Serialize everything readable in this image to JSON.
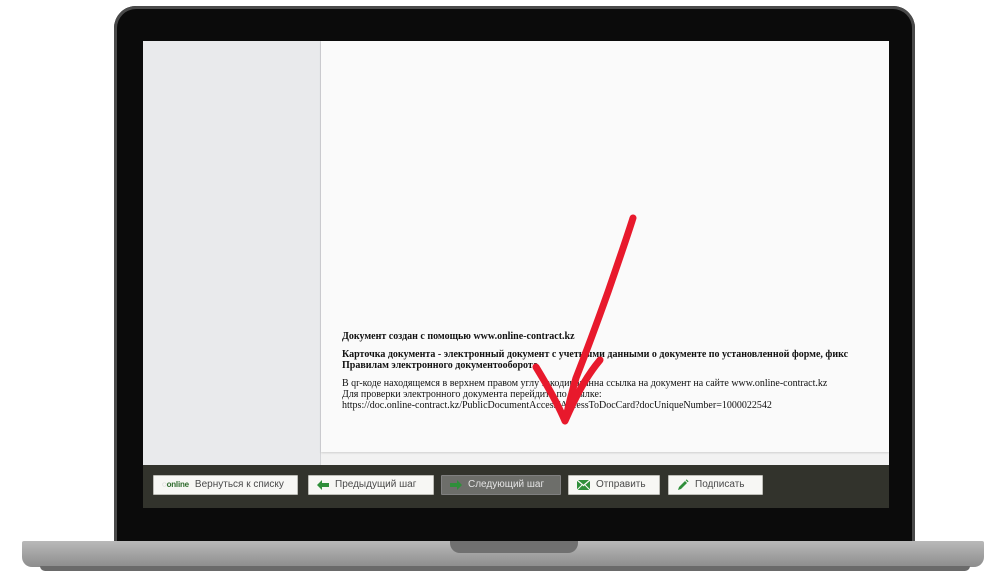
{
  "document": {
    "line1": "Документ создан с помощью www.online-contract.kz",
    "line2": "Карточка документа - электронный документ с учетными данными о документе по установленной форме, фикс",
    "line3": "Правилам электронного документооборота",
    "line4": "В qr-коде находящемся в верхнем правом углу закодированна ссылка на документ на сайте www.online-contract.kz",
    "line5": "Для проверки электронного документа перейдите по ссылке:",
    "line6": "https://doc.online-contract.kz/PublicDocumentAccess/AccessToDocCard?docUniqueNumber=1000022542"
  },
  "toolbar": {
    "logo_text": "online",
    "back_label": "Вернуться к списку",
    "prev_label": "Предыдущий шаг",
    "next_label": "Следующий шаг",
    "send_label": "Отправить",
    "sign_label": "Подписать"
  },
  "colors": {
    "toolbar_bg": "#32332c",
    "accent_green": "#2f8f3a",
    "annotation_red": "#e8192c"
  },
  "icons": {
    "back": "online-logo-icon",
    "prev": "arrow-left-icon",
    "next": "arrow-right-icon",
    "send": "envelope-icon",
    "sign": "pen-icon"
  }
}
